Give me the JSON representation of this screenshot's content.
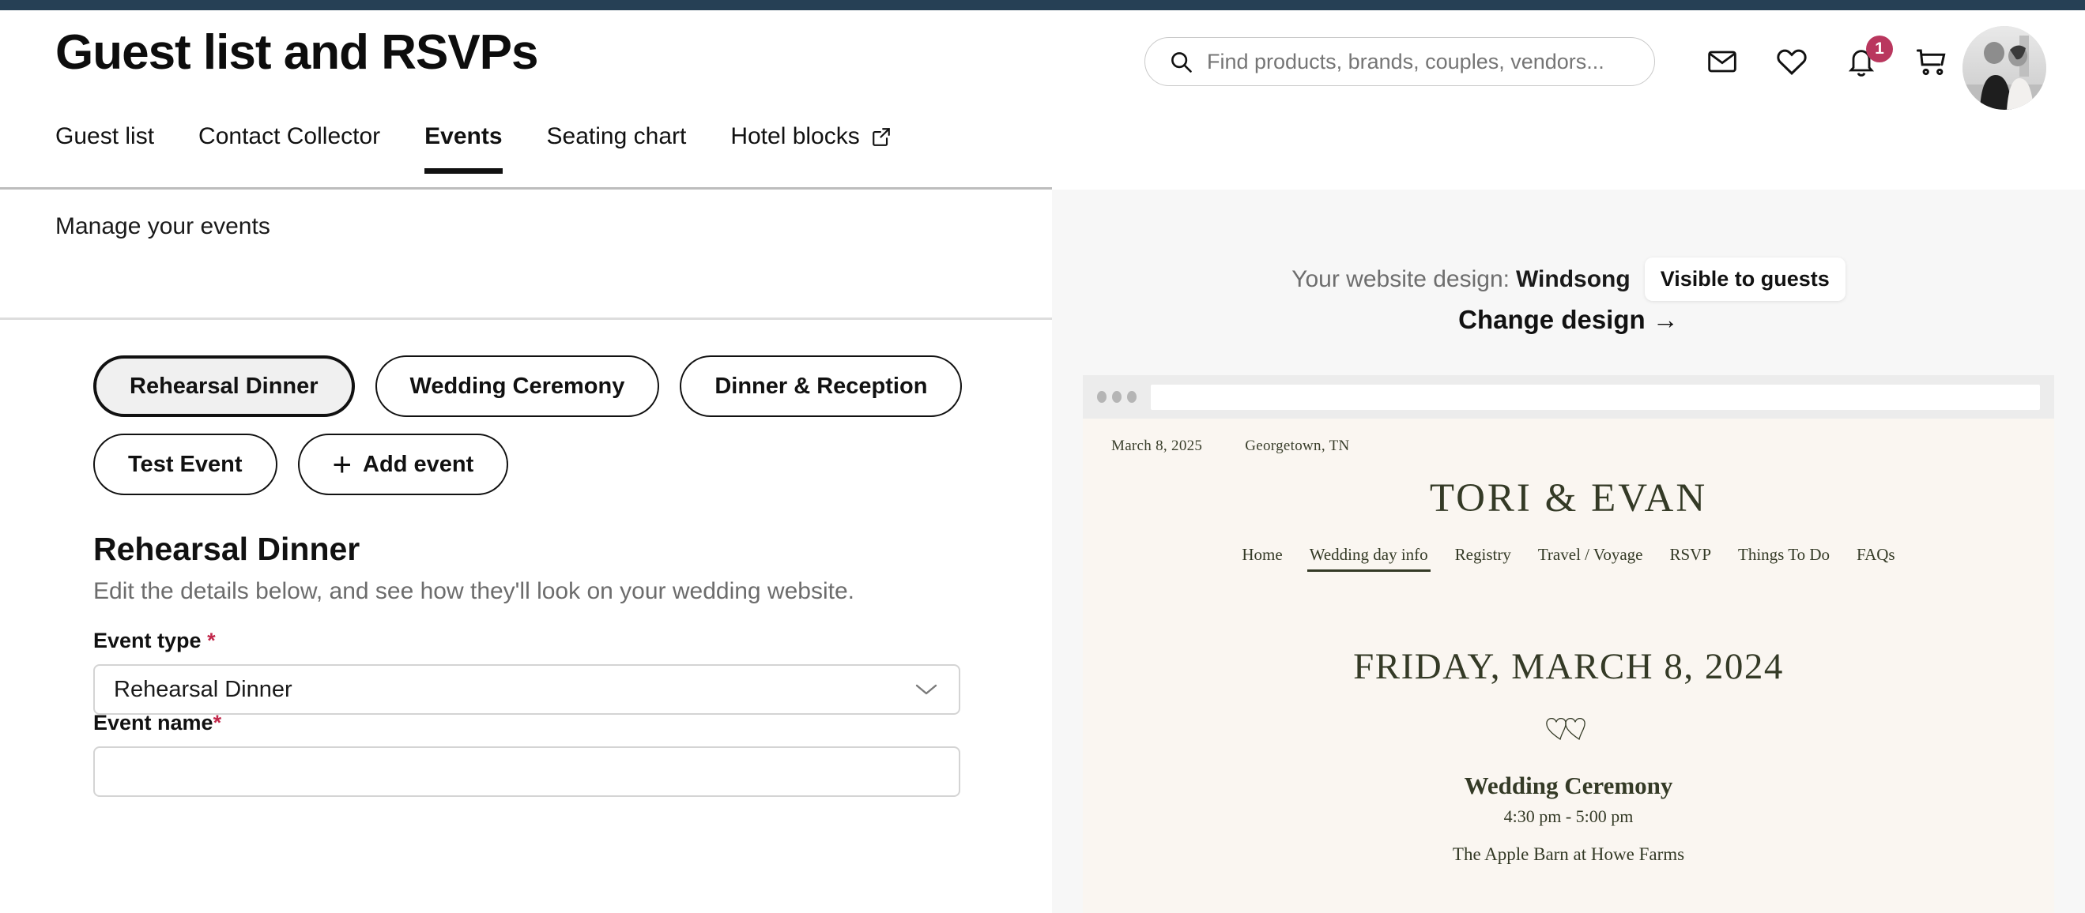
{
  "colors": {
    "top_strip": "#264055",
    "accent_badge": "#b9375e",
    "required_star": "#c2284b",
    "preview_bg": "#f7f7f7",
    "website_cream": "#faf6f1",
    "website_green": "#343a26"
  },
  "header": {
    "page_title": "Guest list and RSVPs",
    "search": {
      "placeholder": "Find products, brands, couples, vendors...",
      "icon": "search-icon"
    },
    "icons": [
      {
        "name": "mail-icon",
        "label": "Messages"
      },
      {
        "name": "heart-icon",
        "label": "Favorites"
      },
      {
        "name": "bell-icon",
        "label": "Notifications",
        "badge": "1"
      },
      {
        "name": "cart-icon",
        "label": "Cart"
      }
    ],
    "avatar": {
      "name": "avatar",
      "label": "Account photo"
    }
  },
  "tabs": [
    {
      "label": "Guest list",
      "active": false,
      "external": false
    },
    {
      "label": "Contact Collector",
      "active": false,
      "external": false
    },
    {
      "label": "Events",
      "active": true,
      "external": false
    },
    {
      "label": "Seating chart",
      "active": false,
      "external": false
    },
    {
      "label": "Hotel blocks",
      "active": false,
      "external": true
    }
  ],
  "left": {
    "manage_label": "Manage your events",
    "event_pills": [
      {
        "label": "Rehearsal Dinner",
        "selected": true
      },
      {
        "label": "Wedding Ceremony",
        "selected": false
      },
      {
        "label": "Dinner & Reception",
        "selected": false
      },
      {
        "label": "Test Event",
        "selected": false
      }
    ],
    "add_event_label": "Add event",
    "add_event_icon": "plus-icon",
    "section_title": "Rehearsal Dinner",
    "section_subtitle": "Edit the details below, and see how they'll look on your wedding website.",
    "fields": {
      "event_type": {
        "label": "Event type",
        "required_mark": "*",
        "value": "Rehearsal Dinner",
        "chevron": "chevron-down-icon"
      },
      "event_name": {
        "label": "Event name",
        "required_mark": "*",
        "value": ""
      }
    }
  },
  "right": {
    "design_prefix": "Your website design:",
    "design_name": "Windsong",
    "visibility_badge": "Visible to guests",
    "change_design": "Change design  →",
    "preview": {
      "meta_date": "March 8, 2025",
      "meta_location": "Georgetown, TN",
      "couple_names": "TORI & EVAN",
      "nav": [
        {
          "label": "Home",
          "active": false
        },
        {
          "label": "Wedding day info",
          "active": true
        },
        {
          "label": "Registry",
          "active": false
        },
        {
          "label": "Travel / Voyage",
          "active": false
        },
        {
          "label": "RSVP",
          "active": false
        },
        {
          "label": "Things To Do",
          "active": false
        },
        {
          "label": "FAQs",
          "active": false
        }
      ],
      "big_date": "FRIDAY, MARCH 8, 2024",
      "divider_icon": "double-hearts-icon",
      "event_name": "Wedding Ceremony",
      "event_time": "4:30 pm - 5:00 pm",
      "event_venue": "The Apple Barn at Howe Farms"
    }
  }
}
